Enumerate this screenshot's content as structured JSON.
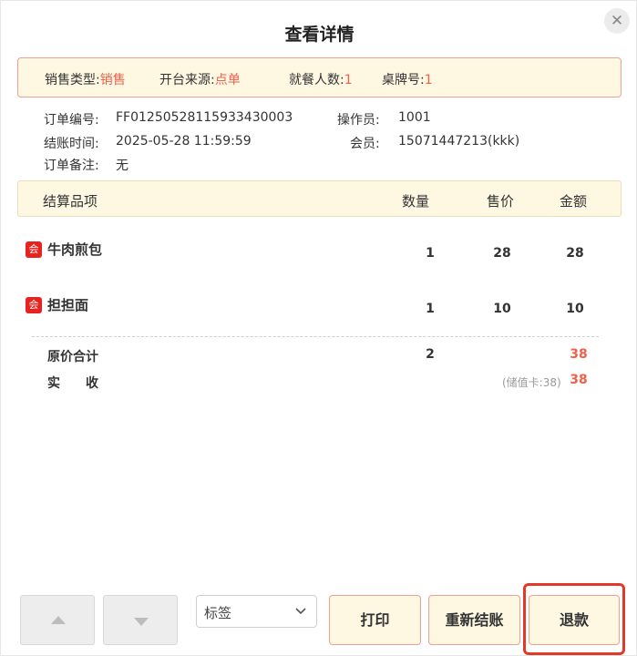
{
  "dialog": {
    "title": "查看详情",
    "close_icon": "close-icon"
  },
  "info": {
    "sale_type_label": "销售类型:",
    "sale_type_value": "销售",
    "source_label": "开台来源:",
    "source_value": "点单",
    "guests_label": "就餐人数:",
    "guests_value": "1",
    "table_label": "桌牌号:",
    "table_value": "1"
  },
  "meta": {
    "order_no_label": "订单编号:",
    "order_no_value": "FF01250528115933430003",
    "operator_label": "操作员:",
    "operator_value": "1001",
    "checkout_time_label": "结账时间:",
    "checkout_time_value": "2025-05-28 11:59:59",
    "member_label": "会员:",
    "member_value": "15071447213(kkk)",
    "remark_label": "订单备注:",
    "remark_value": "无"
  },
  "table": {
    "headers": {
      "item": "结算品项",
      "qty": "数量",
      "price": "售价",
      "amount": "金额"
    },
    "rows": [
      {
        "badge": "会",
        "name": "牛肉煎包",
        "qty": "1",
        "price": "28",
        "amount": "28"
      },
      {
        "badge": "会",
        "name": "担担面",
        "qty": "1",
        "price": "10",
        "amount": "10"
      }
    ]
  },
  "summary": {
    "original_total_label": "原价合计",
    "original_total_qty": "2",
    "original_total_amount": "38",
    "received_label": "实　　收",
    "received_note": "(储值卡:38)",
    "received_amount": "38"
  },
  "footer": {
    "select_value": "标签",
    "print_label": "打印",
    "recheckout_label": "重新结账",
    "refund_label": "退款"
  },
  "colors": {
    "accent": "#f0604a",
    "banner_bg": "#fef8e3",
    "banner_border": "#f0a090",
    "highlight": "#e23a2a"
  }
}
